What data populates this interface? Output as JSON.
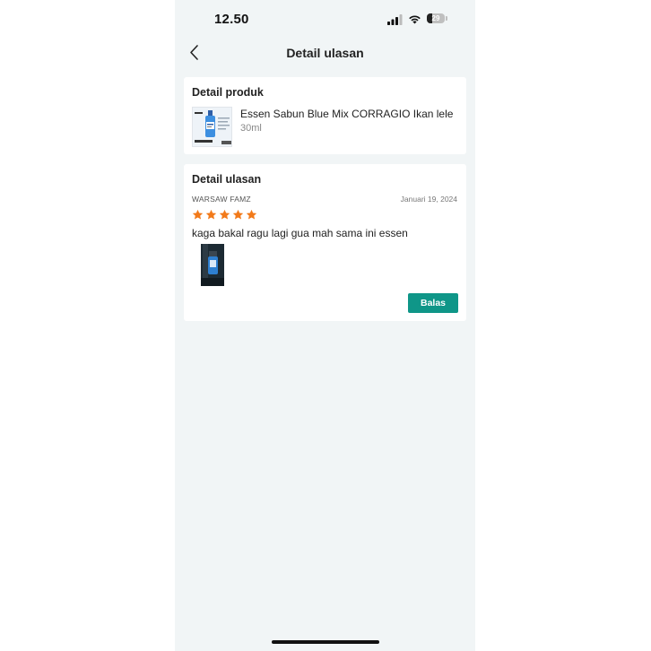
{
  "status_bar": {
    "time": "12.50",
    "battery_level": "29",
    "icons": [
      "signal-icon",
      "wifi-icon",
      "battery-icon"
    ]
  },
  "header": {
    "title": "Detail ulasan",
    "back_icon": "chevron-left-icon"
  },
  "product_card": {
    "title": "Detail produk",
    "product_name": "Essen Sabun Blue Mix CORRAGIO Ikan lele",
    "variant": "30ml"
  },
  "review_card": {
    "title": "Detail ulasan",
    "reviewer": "WARSAW FAMZ",
    "date": "Januari 19, 2024",
    "rating": 5,
    "rating_max": 5,
    "text": "kaga bakal ragu lagi gua mah sama ini essen",
    "reply_label": "Balas"
  },
  "colors": {
    "background": "#f1f5f6",
    "card": "#ffffff",
    "star": "#f27a1a",
    "accent": "#0f9688"
  }
}
